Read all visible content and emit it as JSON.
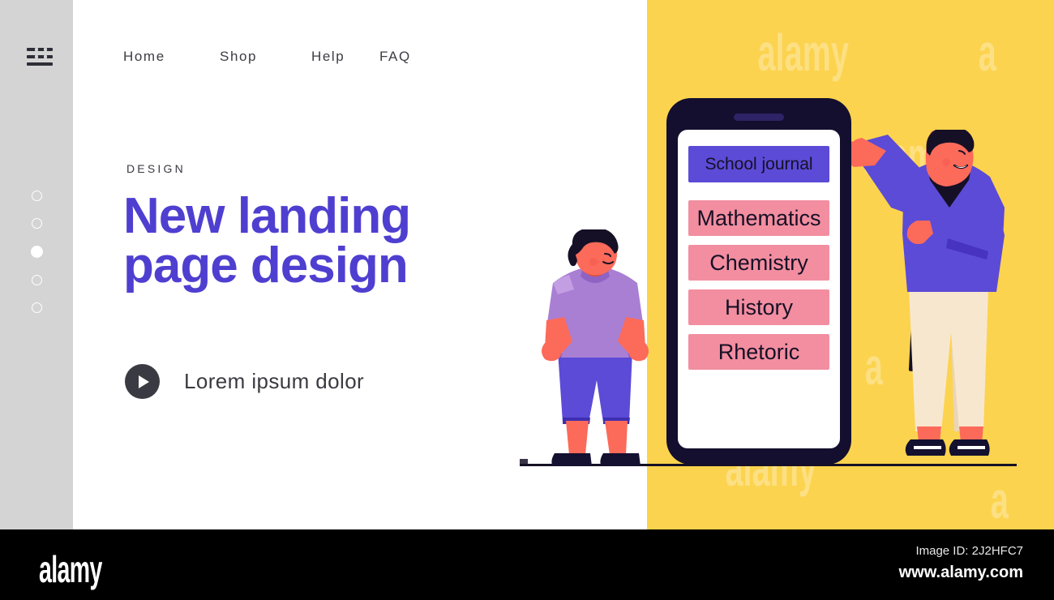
{
  "page": {
    "background": "#ffffff",
    "accent_purple": "#4f3fd0",
    "accent_yellow": "#fcd34e",
    "accent_pink": "#f28ea0",
    "rail_gray": "#d4d4d4"
  },
  "sidebar": {
    "menu_icon": "hamburger-icon",
    "dots": [
      {
        "state": "inactive"
      },
      {
        "state": "inactive"
      },
      {
        "state": "active"
      },
      {
        "state": "inactive"
      },
      {
        "state": "inactive"
      }
    ]
  },
  "nav": {
    "items": [
      {
        "label": "Home"
      },
      {
        "label": "Shop"
      },
      {
        "label": "Help"
      },
      {
        "label": "FAQ"
      }
    ]
  },
  "hero": {
    "eyebrow": "DESIGN",
    "headline_line1": "New landing",
    "headline_line2": "page design",
    "cta": {
      "icon": "play-icon",
      "label": "Lorem ipsum dolor"
    }
  },
  "phone": {
    "menu_header": {
      "label": "School journal",
      "color": "#5b4bd6"
    },
    "subjects": [
      {
        "label": "Mathematics",
        "color": "#f28ea0"
      },
      {
        "label": "Chemistry",
        "color": "#f28ea0"
      },
      {
        "label": "History",
        "color": "#f28ea0"
      },
      {
        "label": "Rhetoric",
        "color": "#f28ea0"
      }
    ]
  },
  "illustration": {
    "student": {
      "name": "standing-student-figure"
    },
    "teacher": {
      "name": "teacher-with-pointer-figure"
    }
  },
  "footer": {
    "logo": "alamy",
    "image_id": "Image ID: 2J2HFC7",
    "website": "www.alamy.com"
  },
  "watermark": {
    "text": "alamy",
    "letter": "a"
  }
}
